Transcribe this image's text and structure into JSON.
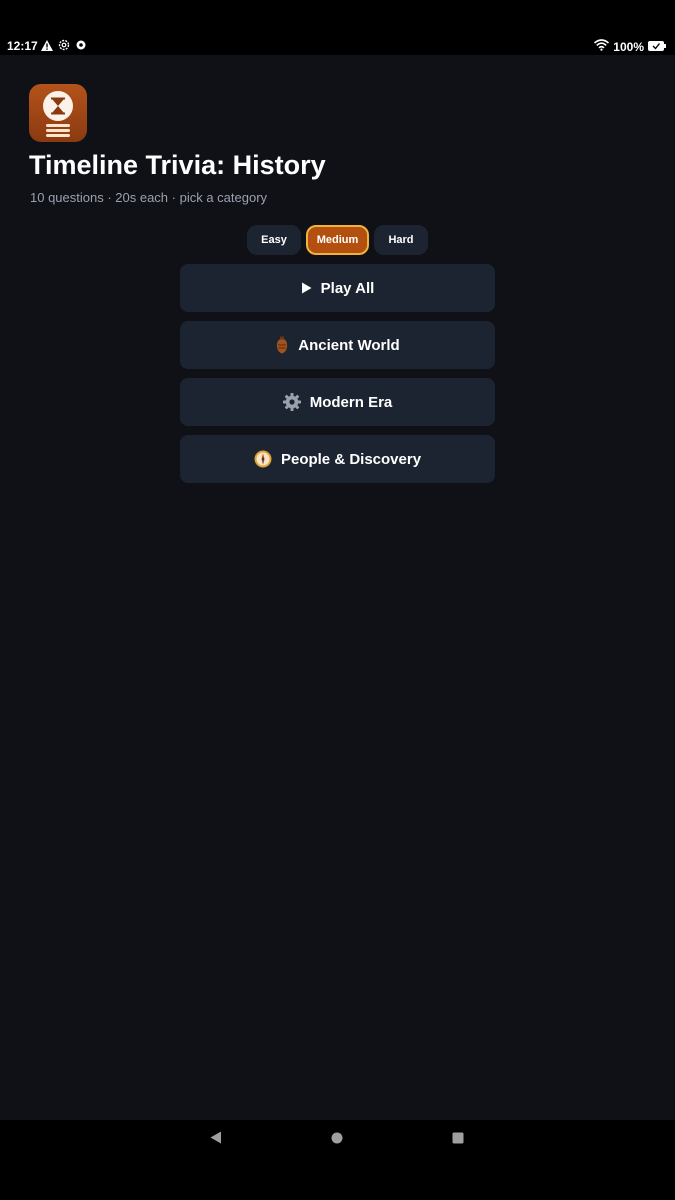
{
  "status_bar": {
    "time": "12:17",
    "battery": "100%",
    "icons_left": [
      "warning-icon",
      "settings-gear-icon",
      "gear-icon"
    ],
    "icons_right": [
      "wifi-icon",
      "battery-icon"
    ]
  },
  "app": {
    "icon": "hourglass-icon",
    "title": "Timeline Trivia: History",
    "subtitle": "10 questions · 20s each · pick a category",
    "accent_color": "#b4500f",
    "highlight_color": "#f0b43c"
  },
  "difficulty": {
    "options": [
      "Easy",
      "Medium",
      "Hard"
    ],
    "selected": "Medium"
  },
  "categories": [
    {
      "label": "Play All",
      "icon": "play-icon"
    },
    {
      "label": "Ancient World",
      "icon": "amphora-icon"
    },
    {
      "label": "Modern Era",
      "icon": "gear-icon"
    },
    {
      "label": "People & Discovery",
      "icon": "compass-icon"
    }
  ],
  "nav_bar": {
    "buttons": [
      "back-icon",
      "home-icon",
      "recents-icon"
    ]
  }
}
